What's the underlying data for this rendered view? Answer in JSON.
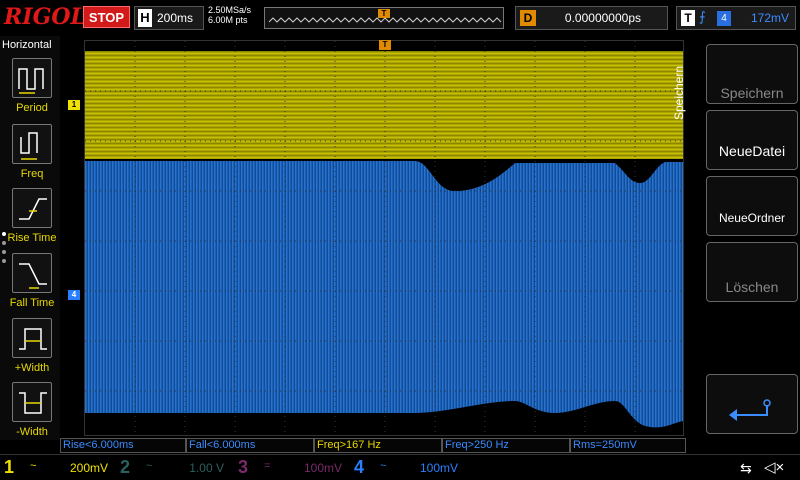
{
  "header": {
    "logo": "RIGOL",
    "run_state": "STOP",
    "horizontal_label": "H",
    "timebase": "200ms",
    "sample_rate": "2.50MSa/s",
    "memory_depth": "6.00M pts",
    "trigger_pos_marker": "T",
    "delay_label": "D",
    "delay_value": "0.00000000ps",
    "trigger_label": "T",
    "trigger_edge": "rising-edge-icon",
    "trigger_source": "4",
    "trigger_level": "172mV"
  },
  "left_menu": {
    "title": "Horizontal",
    "items": [
      {
        "label": "Period",
        "icon": "period-icon"
      },
      {
        "label": "Freq",
        "icon": "freq-icon"
      },
      {
        "label": "Rise Time",
        "icon": "rise-time-icon"
      },
      {
        "label": "Fall Time",
        "icon": "fall-time-icon"
      },
      {
        "label": "+Width",
        "icon": "positive-width-icon"
      },
      {
        "label": "-Width",
        "icon": "negative-width-icon"
      }
    ]
  },
  "markers": {
    "ch1": "1",
    "ch4": "4",
    "trigger_level": "T",
    "trigger_top": "T"
  },
  "right_menu": {
    "title": "Speichern",
    "buttons": [
      {
        "label": "Speichern",
        "state": "dim"
      },
      {
        "label": "NeueDatei",
        "state": "active"
      },
      {
        "label": "NeueOrdner",
        "state": "active"
      },
      {
        "label": "Löschen",
        "state": "dim"
      },
      {
        "label": "",
        "icon": "return-arrow-icon"
      }
    ]
  },
  "measurements": [
    {
      "text": "Rise<6.000ms",
      "color": "#3a8cff"
    },
    {
      "text": "Fall<6.000ms",
      "color": "#3a8cff"
    },
    {
      "text": "Freq>167 Hz",
      "color": "#e8d800"
    },
    {
      "text": "Freq>250 Hz",
      "color": "#3a8cff"
    },
    {
      "text": "Rms=250mV",
      "color": "#3a8cff"
    }
  ],
  "channels": [
    {
      "num": "1",
      "coupling": "~",
      "scale": "200mV",
      "color": "#f0e000"
    },
    {
      "num": "2",
      "coupling": "~",
      "scale": "1.00 V",
      "color": "#2a6060"
    },
    {
      "num": "3",
      "coupling": "=",
      "scale": "100mV",
      "color": "#7a2a6a"
    },
    {
      "num": "4",
      "coupling": "~",
      "scale": "100mV",
      "color": "#2a7fff"
    }
  ],
  "status_icons": {
    "usb": "usb-icon",
    "sound": "speaker-muted-icon"
  },
  "colors": {
    "ch1_trace": "#b8b000",
    "ch4_trace": "#1a5fb8",
    "run_stop": "#d21a1a",
    "delay_badge": "#e08a00"
  }
}
